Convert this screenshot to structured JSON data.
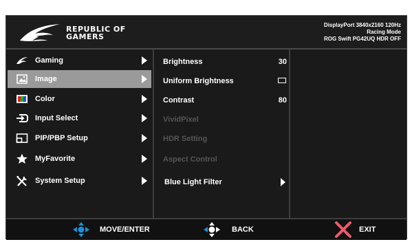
{
  "brand": {
    "logo_text": "REPUBLIC OF\nGAMERS"
  },
  "status": {
    "line1": "DisplayPort 3840x2160 120Hz",
    "line2": "Racing Mode",
    "line3": "ROG Swift PG42UQ HDR OFF"
  },
  "menu": {
    "items": [
      {
        "label": "Gaming",
        "icon": "rog-eye-icon"
      },
      {
        "label": "Image",
        "icon": "image-icon",
        "active": true
      },
      {
        "label": "Color",
        "icon": "color-palette-icon"
      },
      {
        "label": "Input Select",
        "icon": "input-icon"
      },
      {
        "label": "PIP/PBP Setup",
        "icon": "pip-icon"
      },
      {
        "label": "MyFavorite",
        "icon": "star-icon"
      },
      {
        "label": "System Setup",
        "icon": "tools-icon"
      }
    ]
  },
  "submenu": {
    "items": [
      {
        "label": "Brightness",
        "value": "30"
      },
      {
        "label": "Uniform Brightness"
      },
      {
        "label": "Contrast",
        "value": "80"
      },
      {
        "label": "VividPixel"
      },
      {
        "label": "HDR Setting"
      },
      {
        "label": "Aspect Control"
      },
      {
        "label": "Blue Light Filter"
      }
    ]
  },
  "footer": {
    "move_label": "MOVE/ENTER",
    "back_label": "BACK",
    "exit_label": "EXIT"
  },
  "colors": {
    "accent_blue": "#1e8fd6",
    "exit_red": "#f05a6a",
    "active_bg": "#9a9a9a"
  }
}
